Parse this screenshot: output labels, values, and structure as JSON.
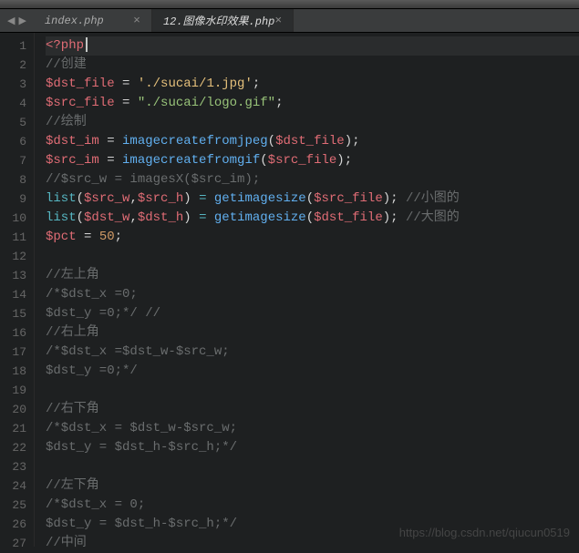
{
  "tabs": [
    {
      "label": "index.php",
      "active": false
    },
    {
      "label": "12.图像水印效果.php",
      "active": true
    }
  ],
  "gutter": [
    "1",
    "2",
    "3",
    "4",
    "5",
    "6",
    "7",
    "8",
    "9",
    "10",
    "11",
    "12",
    "13",
    "14",
    "15",
    "16",
    "17",
    "18",
    "19",
    "20",
    "21",
    "22",
    "23",
    "24",
    "25",
    "26",
    "27"
  ],
  "code": {
    "l1_tag": "<?php",
    "l2": "//创建",
    "l3_var": "$dst_file",
    "l3_eq": " = ",
    "l3_str": "'./sucai/1.jpg'",
    "l3_end": ";",
    "l4_var": "$src_file",
    "l4_eq": " = ",
    "l4_str": "\"./sucai/logo.gif\"",
    "l4_end": ";",
    "l5": "//绘制",
    "l6_var": "$dst_im",
    "l6_eq": " = ",
    "l6_fn": "imagecreatefromjpeg",
    "l6_p1": "(",
    "l6_arg": "$dst_file",
    "l6_p2": ");",
    "l7_var": "$src_im",
    "l7_eq": " = ",
    "l7_fn": "imagecreatefromgif",
    "l7_p1": "(",
    "l7_arg": "$src_file",
    "l7_p2": ");",
    "l8": "//$src_w = imagesX($src_im);",
    "l9_kw": "list",
    "l9_p1": "(",
    "l9_a1": "$src_w",
    "l9_c1": ",",
    "l9_a2": "$src_h",
    "l9_p2": ") ",
    "l9_eq": "= ",
    "l9_fn": "getimagesize",
    "l9_p3": "(",
    "l9_arg": "$src_file",
    "l9_p4": "); ",
    "l9_cm": "//小图的",
    "l10_kw": "list",
    "l10_p1": "(",
    "l10_a1": "$dst_w",
    "l10_c1": ",",
    "l10_a2": "$dst_h",
    "l10_p2": ") ",
    "l10_eq": "= ",
    "l10_fn": "getimagesize",
    "l10_p3": "(",
    "l10_arg": "$dst_file",
    "l10_p4": "); ",
    "l10_cm": "//大图的",
    "l11_var": "$pct",
    "l11_eq": " = ",
    "l11_num": "50",
    "l11_end": ";",
    "l12": "",
    "l13": "//左上角",
    "l14": "/*$dst_x =0;",
    "l15": "$dst_y =0;*/ //",
    "l16": "//右上角",
    "l17": "/*$dst_x =$dst_w-$src_w;",
    "l18": "$dst_y =0;*/",
    "l19": "",
    "l20": "//右下角",
    "l21": "/*$dst_x = $dst_w-$src_w;",
    "l22": "$dst_y = $dst_h-$src_h;*/",
    "l23": "",
    "l24": "//左下角",
    "l25": "/*$dst_x = 0;",
    "l26": "$dst_y = $dst_h-$src_h;*/",
    "l27": "//中间"
  },
  "watermark": "https://blog.csdn.net/qiucun0519"
}
